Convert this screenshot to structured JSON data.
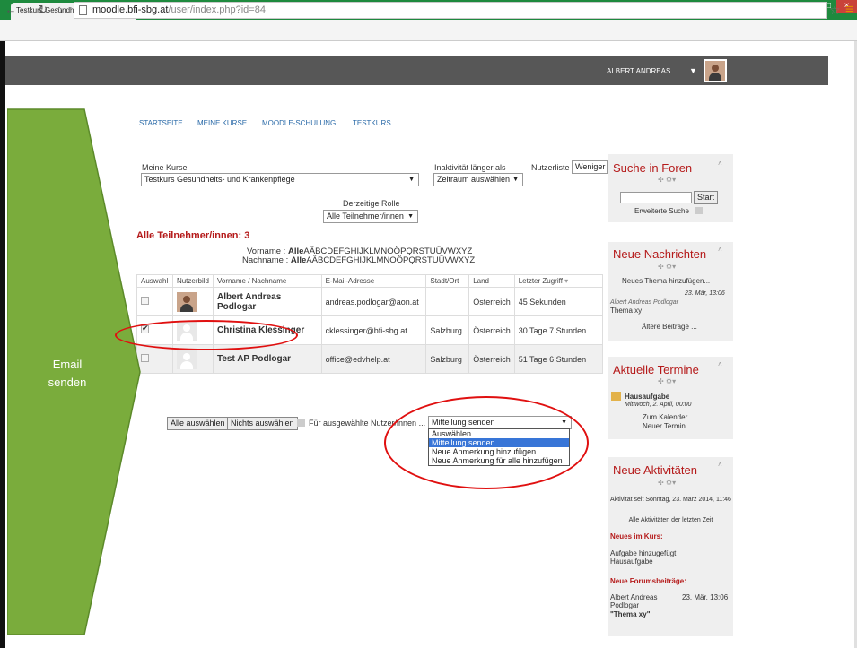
{
  "browser": {
    "tab_title": "Testkurs Gesundheits- und",
    "tab_close": "×",
    "url_host": "moodle.bfi-sbg.at",
    "url_path": "/user/index.php?id=84"
  },
  "header": {
    "user_name": "ALBERT ANDREAS"
  },
  "nav": [
    "STARTSEITE",
    "MEINE KURSE",
    "MOODLE-SCHULUNG",
    "TESTKURS"
  ],
  "filters": {
    "my_courses_label": "Meine Kurse",
    "my_courses_value": "Testkurs Gesundheits- und Krankenpflege",
    "inactivity_label": "Inaktivität länger als",
    "inactivity_value": "Zeitraum auswählen",
    "userlist_label": "Nutzerliste",
    "userlist_value": "Weniger",
    "role_label": "Derzeitige Rolle",
    "role_value": "Alle Teilnehmer/innen"
  },
  "participants": {
    "title": "Alle Teilnehmer/innen: 3",
    "firstname_prefix": "Vorname : ",
    "lastname_prefix": "Nachname : ",
    "all_label": "Alle",
    "letters": "AÄBCDEFGHIJKLMNOÖPQRSTUÜVWXYZ"
  },
  "table": {
    "headers": [
      "Auswahl",
      "Nutzerbild",
      "Vorname / Nachname",
      "E-Mail-Adresse",
      "Stadt/Ort",
      "Land",
      "Letzter Zugriff"
    ],
    "rows": [
      {
        "name": "Albert Andreas Podlogar",
        "email": "andreas.podlogar@aon.at",
        "city": "",
        "country": "Österreich",
        "last": "45 Sekunden",
        "checked": false
      },
      {
        "name": "Christina Klessinger",
        "email": "cklessinger@bfi-sbg.at",
        "city": "Salzburg",
        "country": "Österreich",
        "last": "30 Tage 7 Stunden",
        "checked": true
      },
      {
        "name": "Test AP Podlogar",
        "email": "office@edvhelp.at",
        "city": "Salzburg",
        "country": "Österreich",
        "last": "51 Tage 6 Stunden",
        "checked": false
      }
    ]
  },
  "actions": {
    "select_all": "Alle auswählen",
    "select_none": "Nichts auswählen",
    "for_selected": "Für ausgewählte Nutzer/innen ...",
    "dropdown_value": "Mitteilung senden",
    "dropdown_options": [
      "Auswählen...",
      "Mitteilung senden",
      "Neue Anmerkung hinzufügen",
      "Neue Anmerkung für alle hinzufügen"
    ]
  },
  "sidebar": {
    "search": {
      "title": "Suche in Foren",
      "button": "Start",
      "advanced": "Erweiterte Suche"
    },
    "news": {
      "title": "Neue Nachrichten",
      "add": "Neues Thema hinzufügen...",
      "date": "23. Mär, 13:06",
      "author": "Albert Andreas Podlogar",
      "topic": "Thema xy",
      "older": "Ältere Beiträge ..."
    },
    "events": {
      "title": "Aktuelle Termine",
      "item": "Hausaufgabe",
      "item_date": "Mittwoch, 2. April, 00:00",
      "calendar": "Zum Kalender...",
      "new_event": "Neuer Termin..."
    },
    "activity": {
      "title": "Neue Aktivitäten",
      "since": "Aktivität seit Sonntag, 23. März 2014, 11:46",
      "all": "Alle Aktivitäten der letzten Zeit",
      "course_news_title": "Neues im Kurs:",
      "course_news_line1": "Aufgabe hinzugefügt",
      "course_news_line2": "Hausaufgabe",
      "forum_title": "Neue Forumsbeiträge:",
      "forum_author_1": "Albert Andreas",
      "forum_author_2": "Podlogar",
      "forum_date": "23. Mär, 13:06",
      "forum_topic": "\"Thema xy\""
    }
  },
  "overlay": {
    "arrow_text_1": "Email",
    "arrow_text_2": "senden",
    "arrow_color": "#7aac3c",
    "highlight_color": "#e01010"
  }
}
